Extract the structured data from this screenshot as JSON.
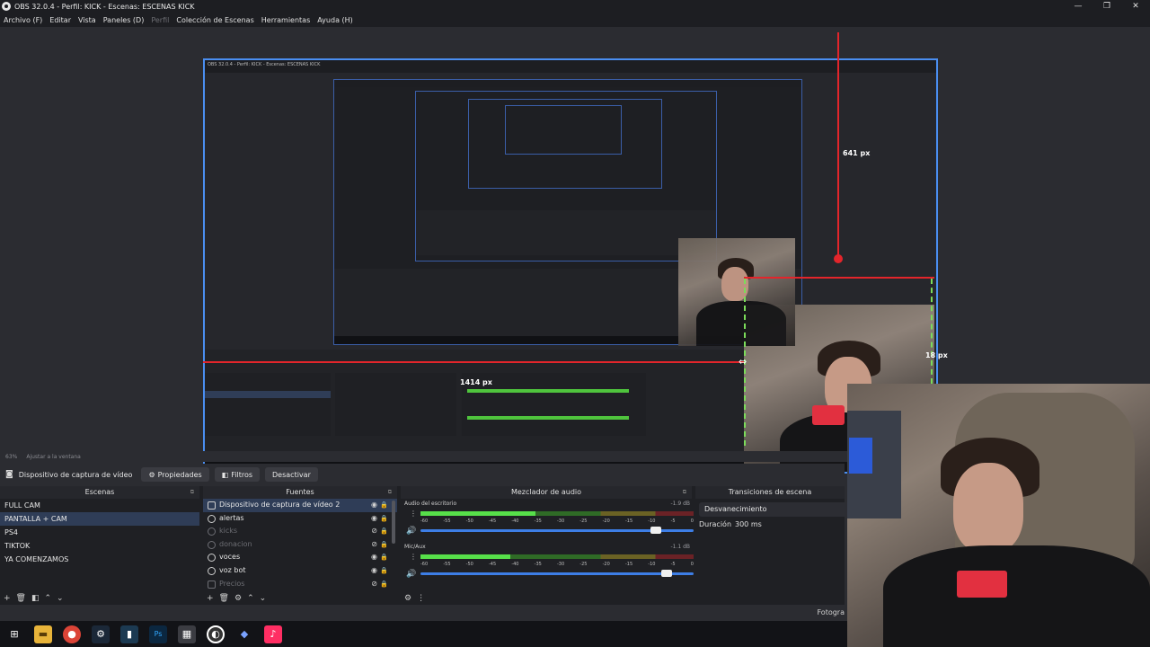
{
  "window": {
    "title": "OBS 32.0.4 - Perfil: KICK - Escenas: ESCENAS KICK",
    "controls": [
      "—",
      "❐",
      "✕"
    ]
  },
  "menu": {
    "items": [
      "Archivo (F)",
      "Editar",
      "Vista",
      "Paneles (D)",
      "Perfil",
      "Colección de Escenas",
      "Herramientas",
      "Ayuda (H)"
    ]
  },
  "preview": {
    "nested_title": "OBS 32.0.4 - Perfil: KICK - Escenas: ESCENAS KICK",
    "measure_top": "641 px",
    "measure_right": "18 px",
    "measure_left": "1414 px",
    "zoom": "63%",
    "fit_label": "Ajustar a la ventana"
  },
  "source_toolbar": {
    "selected_source": "Dispositivo de captura de vídeo",
    "properties": "Propiedades",
    "filters": "Filtros",
    "deactivate": "Desactivar"
  },
  "scenes": {
    "title": "Escenas",
    "items": [
      "FULL CAM",
      "PANTALLA + CAM",
      "PS4",
      "TIKTOK",
      "YA COMENZAMOS"
    ],
    "selected_index": 1
  },
  "sources": {
    "title": "Fuentes",
    "items": [
      {
        "label": "Dispositivo de captura de vídeo 2",
        "visible": true,
        "selected": true
      },
      {
        "label": "alertas",
        "visible": true,
        "selected": false
      },
      {
        "label": "kicks",
        "visible": false,
        "selected": false
      },
      {
        "label": "donacion",
        "visible": false,
        "selected": false
      },
      {
        "label": "voces",
        "visible": true,
        "selected": false
      },
      {
        "label": "voz bot",
        "visible": true,
        "selected": false
      },
      {
        "label": "Precios",
        "visible": false,
        "selected": false
      }
    ]
  },
  "mixer": {
    "title": "Mezclador de audio",
    "channels": [
      {
        "name": "Audio del escritorio",
        "db": "-1.9 dB",
        "level": 0.42,
        "volume": 0.88
      },
      {
        "name": "Mic/Aux",
        "db": "-1.1 dB",
        "level": 0.33,
        "volume": 0.92
      }
    ],
    "scale": [
      "-60",
      "-55",
      "-50",
      "-45",
      "-40",
      "-35",
      "-30",
      "-25",
      "-20",
      "-15",
      "-10",
      "-5",
      "0"
    ]
  },
  "transitions": {
    "title": "Transiciones de escena",
    "selected": "Desvanecimiento",
    "duration_label": "Duración",
    "duration_value": "300 ms"
  },
  "status": {
    "right_text": "Fotogra"
  },
  "taskbar": {
    "icons": [
      "windows-icon",
      "file-explorer-icon",
      "chrome-icon",
      "steam-icon",
      "app-icon",
      "photoshop-icon",
      "calculator-icon",
      "obs-icon",
      "app-diamond-icon",
      "tiktok-icon"
    ]
  },
  "colors": {
    "accent": "#4a8ef0",
    "guide_red": "#e3252b",
    "guide_green": "#7bdc5a",
    "panel_bg": "#1f2024"
  }
}
